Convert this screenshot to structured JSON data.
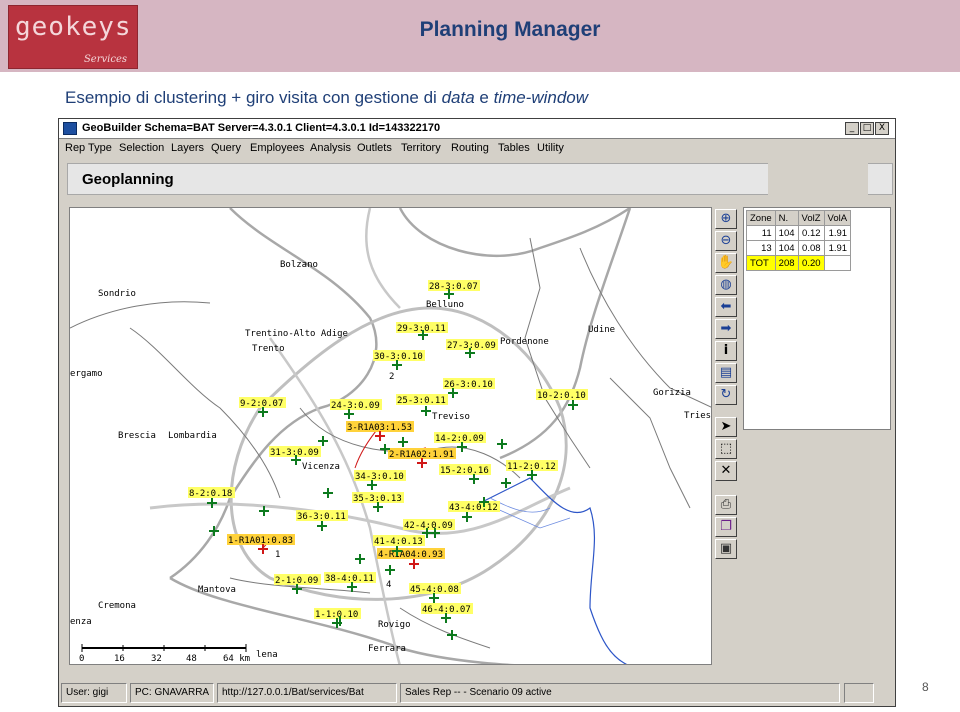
{
  "slide": {
    "logo_text": "geokeys",
    "logo_sub": "Services",
    "title": "Planning Manager",
    "subtitle_pre": "Esempio di clustering + giro visita con gestione di ",
    "subtitle_it1": "data",
    "subtitle_mid": " e ",
    "subtitle_it2": "time-window",
    "page_number": "8"
  },
  "window": {
    "title": "GeoBuilder  Schema=BAT  Server=4.3.0.1  Client=4.3.0.1  Id=143322170",
    "minimize": "_",
    "maximize": "□",
    "close": "X"
  },
  "menu": [
    "Rep Type",
    "Selection",
    "Layers",
    "Query",
    "Employees",
    "Analysis",
    "Outlets",
    "Territory",
    "Routing",
    "Tables",
    "Utility"
  ],
  "panel": {
    "label": "Geoplanning"
  },
  "map": {
    "cities": [
      "Bolzano",
      "Sondrio",
      "Trentino-Alto Adige",
      "Trento",
      "Belluno",
      "Pordenone",
      "Udine",
      "ergamo",
      "Treviso",
      "Vicenza",
      "Gorizia",
      "Tries",
      "Brescia",
      "Lombardia",
      "Mantova",
      "Cremona",
      "enza",
      "Rovigo",
      "Ferrara",
      "lena"
    ],
    "zone_numbers": [
      "1",
      "2",
      "4"
    ],
    "marker_labels": [
      "28-3:0.07",
      "29-3:0.11",
      "27-3:0.09",
      "30-3:0.10",
      "26-3:0.10",
      "10-2:0.10",
      "25-3:0.11",
      "24-3:0.09",
      "9-2:0.07",
      "3-R1A03:1.53",
      "14-2:0.09",
      "2-R1A02:1.91",
      "31-3:0.09",
      "15-2:0.16",
      "11-2:0.12",
      "34-3:0.10",
      "8-2:0.18",
      "35-3:0.13",
      "43-4:0.12",
      "36-3:0.11",
      "42-4:0.09",
      "1-R1A01:0.83",
      "41-4:0.13",
      "4-R1A04:0.93",
      "2-1:0.09",
      "38-4:0.11",
      "45-4:0.08",
      "1-1:0.10",
      "46-4:0.07"
    ],
    "scale_ticks": [
      "0",
      "16",
      "32",
      "48",
      "64 km"
    ]
  },
  "toolbar": [
    "zoom-in-icon",
    "zoom-out-icon",
    "pan-hand-icon",
    "globe-icon",
    "arrow-left-icon",
    "arrow-right-icon",
    "info-icon",
    "legend-icon",
    "refresh-icon",
    "pointer-icon",
    "select-box-icon",
    "delete-icon",
    "print-icon",
    "copy-icon",
    "save-icon"
  ],
  "zones": {
    "headers": [
      "Zone",
      "N.",
      "VolZ",
      "VolA"
    ],
    "rows": [
      [
        "11",
        "104",
        "0.12",
        "1.91"
      ],
      [
        "13",
        "104",
        "0.08",
        "1.91"
      ]
    ],
    "total": [
      "TOT",
      "208",
      "0.20",
      ""
    ]
  },
  "status": {
    "user": "User: gigi",
    "pc": "PC: GNAVARRA",
    "url": "http://127.0.0.1/Bat/services/Bat",
    "mode": "Sales Rep --  - Scenario 09 active"
  },
  "colors": {
    "header_band": "#d6b6c2",
    "title": "#1f3f77",
    "marker_green": "#0d7a1e",
    "marker_red": "#d01818",
    "label_yellow": "#ffff66",
    "label_red_bg": "#ffd23a"
  }
}
